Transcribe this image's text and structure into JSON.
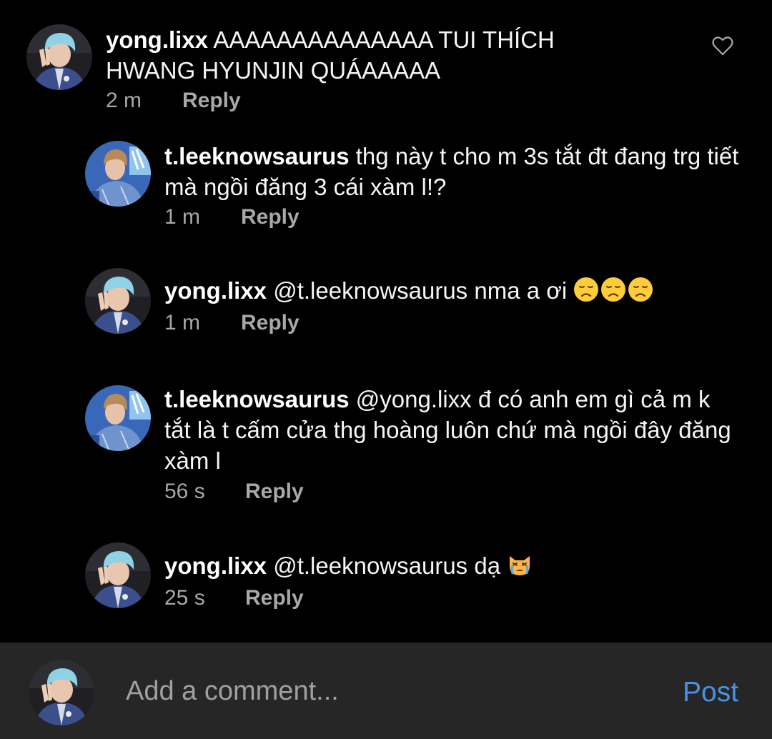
{
  "comments": [
    {
      "username": "yong.lixx",
      "text": "AAAAAAAAAAAAAA TUI THÍCH HWANG HYUNJIN QUÁAAAAA",
      "time": "2 m",
      "reply_label": "Reply",
      "avatar": "blonde-blue-hair-avatar",
      "liked": false
    },
    {
      "username": "t.leeknowsaurus",
      "text": "thg này t cho m 3s tắt đt đang trg tiết mà ngồi đăng 3 cái xàm l!?",
      "time": "1 m",
      "reply_label": "Reply",
      "avatar": "brown-hair-blue-jacket-avatar"
    },
    {
      "username": "yong.lixx",
      "text": "@t.leeknowsaurus nma a ơi",
      "emojis": [
        "disappointed-face",
        "disappointed-face",
        "disappointed-face"
      ],
      "time": "1 m",
      "reply_label": "Reply",
      "avatar": "blonde-blue-hair-avatar"
    },
    {
      "username": "t.leeknowsaurus",
      "text": "@yong.lixx đ có anh em gì cả m k tắt là t cấm cửa thg hoàng luôn chứ mà ngồi đây đăng xàm l",
      "time": "56 s",
      "reply_label": "Reply",
      "avatar": "brown-hair-blue-jacket-avatar"
    },
    {
      "username": "yong.lixx",
      "text": "@t.leeknowsaurus dạ",
      "emojis": [
        "crying-cat-face"
      ],
      "time": "25 s",
      "reply_label": "Reply",
      "avatar": "blonde-blue-hair-avatar"
    }
  ],
  "composer": {
    "placeholder": "Add a comment...",
    "post_label": "Post",
    "avatar": "blonde-blue-hair-avatar"
  },
  "colors": {
    "background": "#000000",
    "composer_background": "#262626",
    "secondary_text": "#a8a8a8",
    "post_link": "#4a92e6",
    "emoji_yellow": "#ffcc3a"
  }
}
